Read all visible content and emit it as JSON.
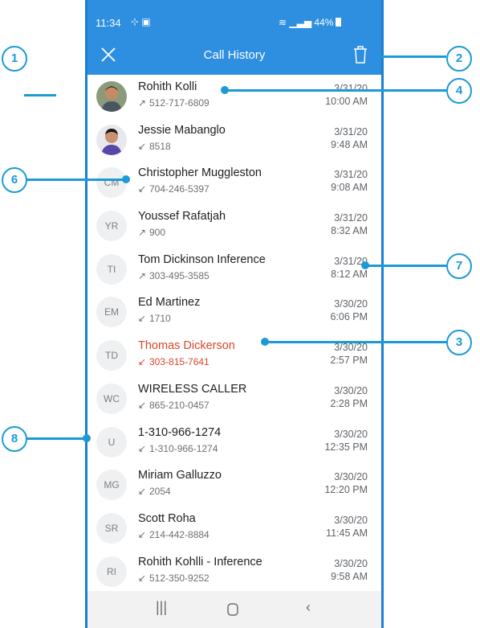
{
  "status": {
    "time": "11:34",
    "signal": "44%"
  },
  "header": {
    "title": "Call History"
  },
  "calls": [
    {
      "name": "Rohith Kolli",
      "number": "512-717-6809",
      "dir": "out",
      "date": "3/31/20",
      "time": "10:00 AM",
      "initials": "",
      "photo": "male-1"
    },
    {
      "name": "Jessie Mabanglo",
      "number": "8518",
      "dir": "in",
      "date": "3/31/20",
      "time": "9:48 AM",
      "initials": "",
      "photo": "male-2"
    },
    {
      "name": "Christopher Muggleston",
      "number": "704-246-5397",
      "dir": "in",
      "date": "3/31/20",
      "time": "9:08 AM",
      "initials": "CM"
    },
    {
      "name": "Youssef Rafatjah",
      "number": "900",
      "dir": "out",
      "date": "3/31/20",
      "time": "8:32 AM",
      "initials": "YR"
    },
    {
      "name": "Tom Dickinson Inference",
      "number": "303-495-3585",
      "dir": "out",
      "date": "3/31/20",
      "time": "8:12 AM",
      "initials": "TI"
    },
    {
      "name": "Ed Martinez",
      "number": "1710",
      "dir": "in",
      "date": "3/30/20",
      "time": "6:06 PM",
      "initials": "EM"
    },
    {
      "name": "Thomas Dickerson",
      "number": "303-815-7641",
      "dir": "in",
      "date": "3/30/20",
      "time": "2:57 PM",
      "initials": "TD",
      "missed": true
    },
    {
      "name": "WIRELESS CALLER",
      "number": "865-210-0457",
      "dir": "in",
      "date": "3/30/20",
      "time": "2:28 PM",
      "initials": "WC"
    },
    {
      "name": "1-310-966-1274",
      "number": "1-310-966-1274",
      "dir": "in",
      "date": "3/30/20",
      "time": "12:35 PM",
      "initials": "U"
    },
    {
      "name": "Miriam Galluzzo",
      "number": "2054",
      "dir": "in",
      "date": "3/30/20",
      "time": "12:20 PM",
      "initials": "MG"
    },
    {
      "name": "Scott Roha",
      "number": "214-442-8884",
      "dir": "in",
      "date": "3/30/20",
      "time": "11:45 AM",
      "initials": "SR"
    },
    {
      "name": "Rohith Kohlli - Inference",
      "number": "512-350-9252",
      "dir": "in",
      "date": "3/30/20",
      "time": "9:58 AM",
      "initials": "RI"
    }
  ],
  "callouts": [
    "1",
    "2",
    "3",
    "4",
    "6",
    "7",
    "8"
  ],
  "colors": {
    "accent": "#2e8fe0",
    "callout": "#1c9ad6",
    "missed": "#d9472b"
  }
}
